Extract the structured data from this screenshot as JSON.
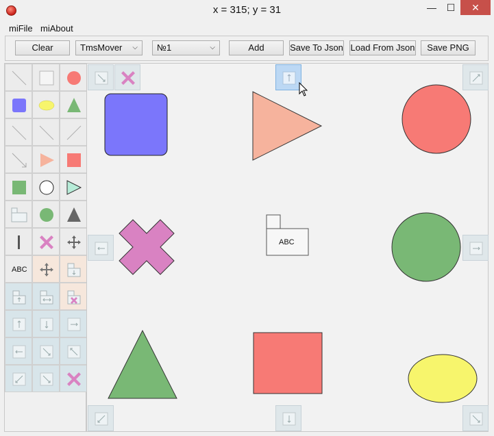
{
  "window": {
    "title": "x = 315; y = 31",
    "minimize_glyph": "—",
    "maximize_glyph": "☐",
    "close_glyph": "✕"
  },
  "menu": {
    "items": [
      "miFile",
      "miAbout"
    ]
  },
  "toolbar": {
    "clear_label": "Clear",
    "mover_select": "TmsMover",
    "number_select": "№1",
    "add_label": "Add",
    "save_json_label": "Save To Json",
    "load_json_label": "Load From Json",
    "save_png_label": "Save PNG"
  },
  "palette": {
    "rows": [
      [
        "line-diagonal-icon",
        "white-square-icon",
        "red-circle-icon"
      ],
      [
        "blue-rounded-square-icon",
        "yellow-ellipse-icon",
        "green-triangle-icon"
      ],
      [
        "line-diagonal-icon",
        "line-diagonal-icon",
        "line-diagonal-icon"
      ],
      [
        "arrow-line-icon",
        "orange-triangle-icon",
        "red-square-icon"
      ],
      [
        "green-square-icon",
        "white-circle-icon",
        "cyan-triangle-icon"
      ],
      [
        "tab-folder-icon",
        "green-circle-icon",
        "gray-triangle-icon"
      ],
      [
        "vertical-line-icon",
        "pink-cross-icon",
        "move-arrows-icon"
      ],
      [
        "abc-text-icon",
        "move-arrows-icon",
        "resize-down-icon"
      ],
      [
        "resize-up-icon",
        "resize-horizontal-icon",
        "delete-cross-icon"
      ],
      [
        "handle-up-icon",
        "handle-down-icon",
        "handle-right-icon"
      ],
      [
        "handle-left-icon",
        "handle-diag-icon",
        "handle-diag-icon"
      ],
      [
        "handle-corner-icon",
        "handle-corner-icon",
        "delete-cross-icon"
      ]
    ],
    "abc_text": "ABC"
  },
  "canvas": {
    "text_block_label": "ABC",
    "colors": {
      "blue": "#7b76fb",
      "salmon": "#f6b39d",
      "red": "#f77a75",
      "green": "#79b875",
      "pink": "#d982c2",
      "yellow": "#f7f56c"
    }
  }
}
